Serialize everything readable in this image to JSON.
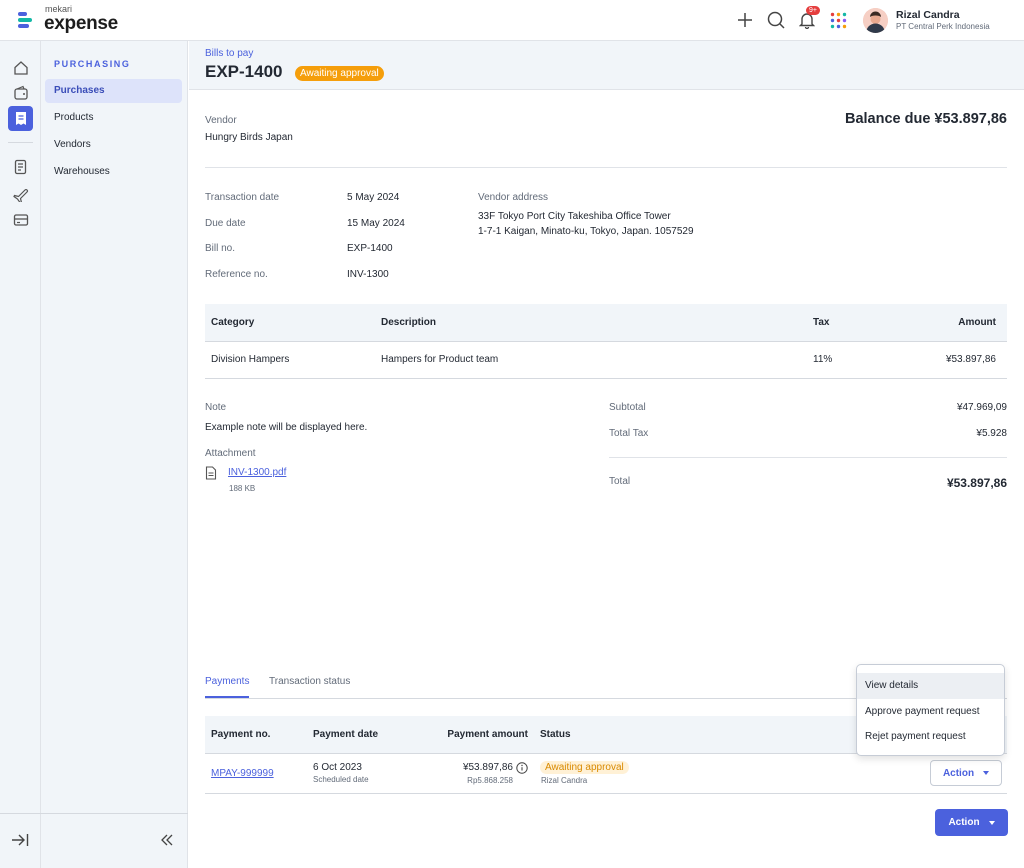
{
  "brand": {
    "small": "mekari",
    "big": "expense"
  },
  "topbar": {
    "notification_badge": "9+",
    "user_name": "Rizal Candra",
    "user_company": "PT Central Perk Indonesia"
  },
  "sidebar": {
    "section": "PURCHASING",
    "items": [
      {
        "label": "Purchases"
      },
      {
        "label": "Products"
      },
      {
        "label": "Vendors"
      },
      {
        "label": "Warehouses"
      }
    ]
  },
  "header": {
    "breadcrumb": "Bills to pay",
    "title": "EXP-1400",
    "status": "Awaiting approval"
  },
  "bill": {
    "vendor_label": "Vendor",
    "vendor": "Hungry Birds Japan",
    "balance_due": "Balance due ¥53.897,86",
    "transaction_date_label": "Transaction date",
    "transaction_date": "5 May 2024",
    "due_date_label": "Due date",
    "due_date": "15 May 2024",
    "bill_no_label": "Bill no.",
    "bill_no": "EXP-1400",
    "reference_label": "Reference no.",
    "reference": "INV-1300",
    "vendor_address_label": "Vendor address",
    "vendor_address_line1": "33F Tokyo Port City Takeshiba Office Tower",
    "vendor_address_line2": "1-7-1 Kaigan, Minato-ku, Tokyo, Japan. 1057529"
  },
  "items_table": {
    "headers": {
      "category": "Category",
      "description": "Description",
      "tax": "Tax",
      "amount": "Amount"
    },
    "rows": [
      {
        "category": "Division Hampers",
        "description": "Hampers for Product team",
        "tax": "11%",
        "amount": "¥53.897,86"
      }
    ]
  },
  "note": {
    "label": "Note",
    "text": "Example note will be displayed here.",
    "attachment_label": "Attachment",
    "file_name": "INV-1300.pdf",
    "file_size": "188 KB"
  },
  "totals": {
    "subtotal_label": "Subtotal",
    "subtotal": "¥47.969,09",
    "total_tax_label": "Total Tax",
    "total_tax": "¥5.928",
    "total_label": "Total",
    "total": "¥53.897,86"
  },
  "tabs": {
    "payments": "Payments",
    "transaction_status": "Transaction status"
  },
  "payments_table": {
    "headers": {
      "payment_no": "Payment no.",
      "payment_date": "Payment date",
      "payment_amount": "Payment amount",
      "status": "Status"
    },
    "rows": [
      {
        "payment_no": "MPAY-999999",
        "payment_date": "6 Oct 2023",
        "payment_date_sub": "Scheduled date",
        "amount": "¥53.897,86",
        "amount_sub": "Rp5.868.258",
        "status": "Awaiting approval",
        "status_by": "Rizal Candra",
        "action": "Action"
      }
    ]
  },
  "dropdown": {
    "items": [
      "View details",
      "Approve payment request",
      "Rejet payment request"
    ]
  },
  "footer": {
    "action_button": "Action"
  },
  "colors": {
    "primary": "#4b61dd",
    "warning": "#f59e0b",
    "warning_soft": "#fff1d6",
    "surface": "#f1f5f9"
  }
}
